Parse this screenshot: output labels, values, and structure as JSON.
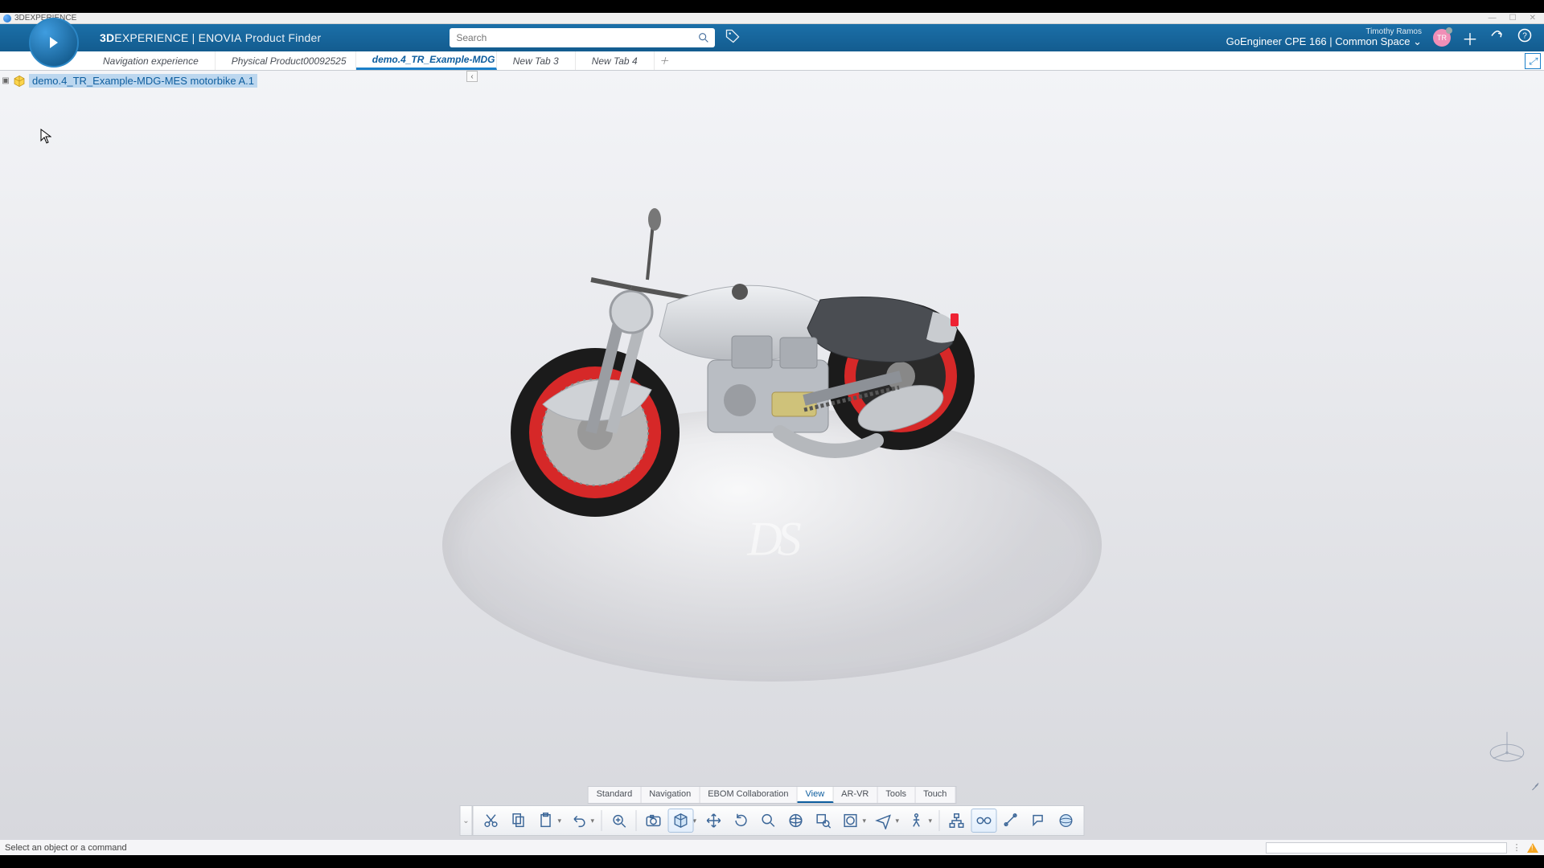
{
  "os_title": "3DEXPERIENCE",
  "brand": {
    "prefix": "3D",
    "main": "EXPERIENCE",
    "sep": " | ",
    "suite": "ENOVIA",
    "product": "Product Finder"
  },
  "search": {
    "placeholder": "Search"
  },
  "user": {
    "name": "Timothy Ramos",
    "space": "GoEngineer CPE 166 | Common Space",
    "initials": "TR"
  },
  "tabs": [
    {
      "label": "Navigation experience",
      "active": false
    },
    {
      "label": "Physical Product00092525",
      "active": false
    },
    {
      "label": "demo.4_TR_Example-MDG",
      "active": true
    },
    {
      "label": "New Tab 3",
      "active": false
    },
    {
      "label": "New Tab 4",
      "active": false
    }
  ],
  "tree": {
    "root_label": "demo.4_TR_Example-MDG-MES motorbike A.1"
  },
  "tooltabs": [
    "Standard",
    "Navigation",
    "EBOM Collaboration",
    "View",
    "AR-VR",
    "Tools",
    "Touch"
  ],
  "tooltab_active": "View",
  "actionbar_icons": [
    "cut-icon",
    "copy-icon",
    "paste-icon",
    "undo-icon",
    "zoom-fit-icon",
    "camera-icon",
    "cube-view-icon",
    "pan-icon",
    "rotate-icon",
    "zoom-icon",
    "globe-icon",
    "zoom-area-icon",
    "layer-box-icon",
    "plane-fly-icon",
    "walk-icon",
    "hierarchy-icon",
    "relation-icon",
    "measure-icon",
    "annotation-icon",
    "sphere-icon"
  ],
  "status": {
    "hint": "Select an object or a command"
  }
}
